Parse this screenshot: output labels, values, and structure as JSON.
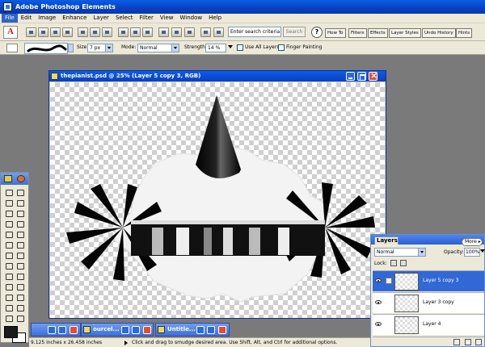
{
  "window": {
    "title": "Adobe Photoshop Elements"
  },
  "menu": [
    "File",
    "Edit",
    "Image",
    "Enhance",
    "Layer",
    "Select",
    "Filter",
    "View",
    "Window",
    "Help"
  ],
  "shortcuts": {
    "search_placeholder": "Enter search criteria",
    "search_button": "Search",
    "help_label": "?",
    "bin_tabs": [
      "How To",
      "Filters",
      "Effects",
      "Layer Styles",
      "Undo History",
      "Hints"
    ]
  },
  "options": {
    "size_label": "Size:",
    "size_value": "7 px",
    "mode_label": "Mode:",
    "mode_value": "Normal",
    "strength_label": "Strength:",
    "strength_value": "14 %",
    "use_all_layers": "Use All Layers",
    "finger_painting": "Finger Painting"
  },
  "document": {
    "title": "thepianist.psd @ 25% (Layer 5 copy 3, RGB)"
  },
  "minimized": [
    {
      "label": ""
    },
    {
      "label": "ourcel..."
    },
    {
      "label": "Untitle..."
    }
  ],
  "status": {
    "size": "9.125 inches x 26.458 inches",
    "hint": "Click and drag to smudge desired area.  Use Shift, Alt, and Ctrl for additional options."
  },
  "layers": {
    "tab": "Layers",
    "more": "More",
    "blend_mode": "Normal",
    "opacity_label": "Opacity:",
    "opacity_value": "100%",
    "lock_label": "Lock:",
    "rows": [
      {
        "name": "Layer 5 copy 3",
        "selected": true
      },
      {
        "name": "Layer 3 copy",
        "selected": false
      },
      {
        "name": "Layer 4",
        "selected": false
      }
    ]
  }
}
